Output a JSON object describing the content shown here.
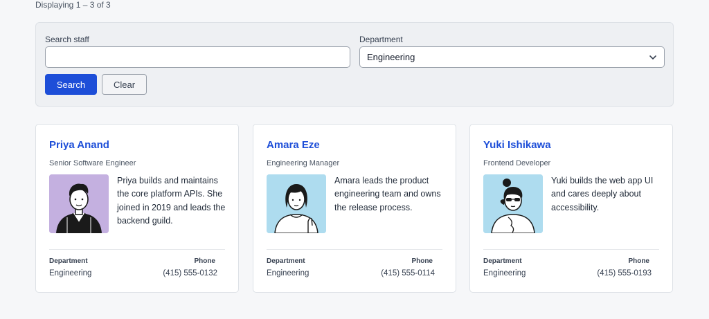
{
  "results": {
    "count_text": "Displaying 1 – 3 of 3"
  },
  "filters": {
    "search_label": "Search staff",
    "search_value": "",
    "search_placeholder": "",
    "department_label": "Department",
    "department_selected": "Engineering",
    "search_button": "Search",
    "clear_button": "Clear"
  },
  "colors": {
    "accent": "#1d4ed8",
    "avatar_purple": "#c4b0e0",
    "avatar_blue": "#aedcef"
  },
  "cards": [
    {
      "name": "Priya Anand",
      "title": "Senior Software Engineer",
      "bio": "Priya builds and maintains the core platform APIs. She joined in 2019 and leads the backend guild.",
      "department_label": "Department",
      "department": "Engineering",
      "phone_label": "Phone",
      "phone": "(415) 555-0132",
      "avatar_icon": "person-illustration-icon"
    },
    {
      "name": "Amara Eze",
      "title": "Engineering Manager",
      "bio": "Amara leads the product engineering team and owns the release process.",
      "department_label": "Department",
      "department": "Engineering",
      "phone_label": "Phone",
      "phone": "(415) 555-0114",
      "avatar_icon": "person-illustration-icon"
    },
    {
      "name": "Yuki Ishikawa",
      "title": "Frontend Developer",
      "bio": "Yuki builds the web app UI and cares deeply about accessibility.",
      "department_label": "Department",
      "department": "Engineering",
      "phone_label": "Phone",
      "phone": "(415) 555-0193",
      "avatar_icon": "person-illustration-icon"
    }
  ]
}
